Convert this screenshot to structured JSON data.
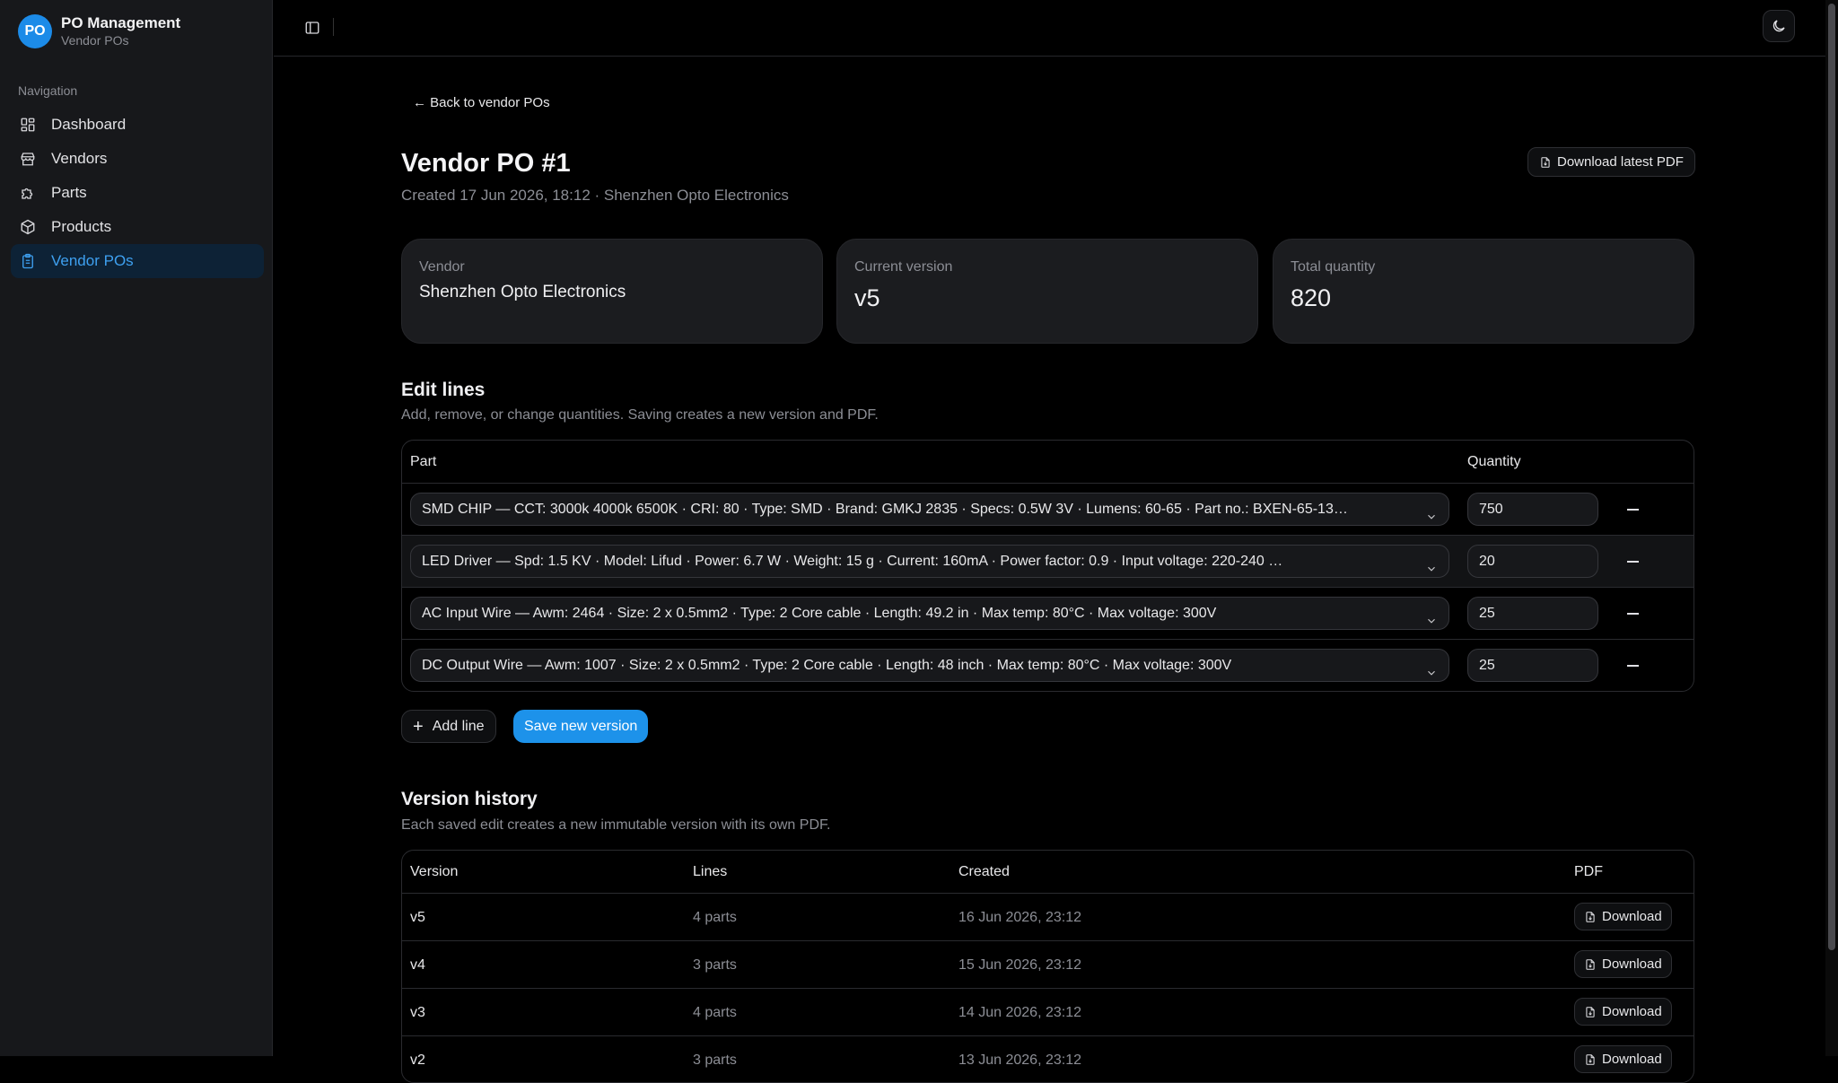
{
  "app": {
    "logo_text": "PO",
    "name": "PO Management",
    "section": "Vendor POs"
  },
  "nav": {
    "label": "Navigation",
    "items": [
      {
        "label": "Dashboard",
        "icon": "dashboard-icon"
      },
      {
        "label": "Vendors",
        "icon": "store-icon"
      },
      {
        "label": "Parts",
        "icon": "puzzle-icon"
      },
      {
        "label": "Products",
        "icon": "package-icon"
      },
      {
        "label": "Vendor POs",
        "icon": "clipboard-icon",
        "active": true
      }
    ]
  },
  "page": {
    "back": "← Back to vendor POs",
    "title": "Vendor PO #1",
    "subtitle": "Created 17 Jun 2026, 18:12 · Shenzhen Opto Electronics",
    "download_latest": "Download latest PDF"
  },
  "cards": {
    "vendor": {
      "label": "Vendor",
      "value": "Shenzhen Opto Electronics"
    },
    "version": {
      "label": "Current version",
      "value": "v5"
    },
    "quantity": {
      "label": "Total quantity",
      "value": "820"
    }
  },
  "edit": {
    "title": "Edit lines",
    "subtitle": "Add, remove, or change quantities. Saving creates a new version and PDF.",
    "col_part": "Part",
    "col_qty": "Quantity",
    "rows": [
      {
        "part": "SMD CHIP — CCT: 3000k 4000k 6500K · CRI: 80 · Type: SMD · Brand: GMKJ 2835 · Specs: 0.5W 3V · Lumens: 60-65 · Part no.: BXEN-65-13…",
        "qty": "750"
      },
      {
        "part": "LED Driver — Spd: 1.5 KV · Model: Lifud · Power: 6.7 W · Weight: 15 g · Current: 160mA · Power factor: 0.9 · Input voltage: 220-240 …",
        "qty": "20"
      },
      {
        "part": "AC Input Wire — Awm: 2464 · Size: 2 x 0.5mm2 · Type: 2 Core cable · Length: 49.2 in · Max temp: 80°C · Max voltage: 300V",
        "qty": "25"
      },
      {
        "part": "DC Output Wire — Awm: 1007 · Size: 2 x 0.5mm2 · Type: 2 Core cable · Length: 48 inch · Max temp: 80°C · Max voltage: 300V",
        "qty": "25"
      }
    ],
    "add_line": "Add line",
    "save": "Save new version"
  },
  "history": {
    "title": "Version history",
    "subtitle": "Each saved edit creates a new immutable version with its own PDF.",
    "cols": [
      "Version",
      "Lines",
      "Created",
      "PDF"
    ],
    "rows": [
      {
        "version": "v5",
        "lines": "4 parts",
        "created": "16 Jun 2026, 23:12",
        "pdf": "Download"
      },
      {
        "version": "v4",
        "lines": "3 parts",
        "created": "15 Jun 2026, 23:12",
        "pdf": "Download"
      },
      {
        "version": "v3",
        "lines": "4 parts",
        "created": "14 Jun 2026, 23:12",
        "pdf": "Download"
      },
      {
        "version": "v2",
        "lines": "3 parts",
        "created": "13 Jun 2026, 23:12",
        "pdf": "Download"
      }
    ]
  },
  "colors": {
    "accent": "#1d92ea",
    "background": "#000000",
    "sidebar": "#17181b"
  }
}
